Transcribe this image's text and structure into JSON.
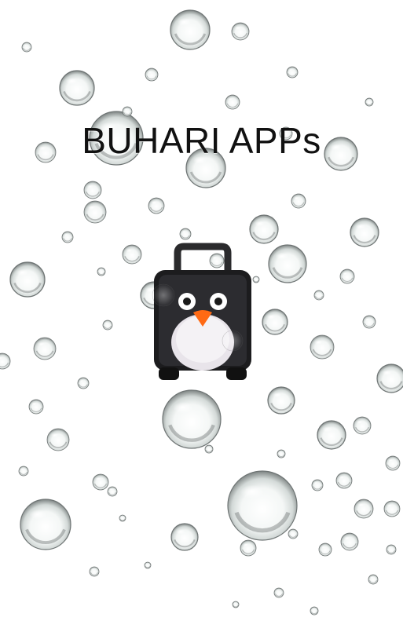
{
  "app": {
    "title": "BUHARI APPs"
  },
  "splash": {
    "background_color": "#ffffff",
    "logo_icon": "penguin-suitcase-icon",
    "background_icon": "water-droplets",
    "accent_colors": {
      "suitcase": "#1c1c1e",
      "beak": "#ff6a14",
      "belly": "#e8e4ea"
    }
  }
}
